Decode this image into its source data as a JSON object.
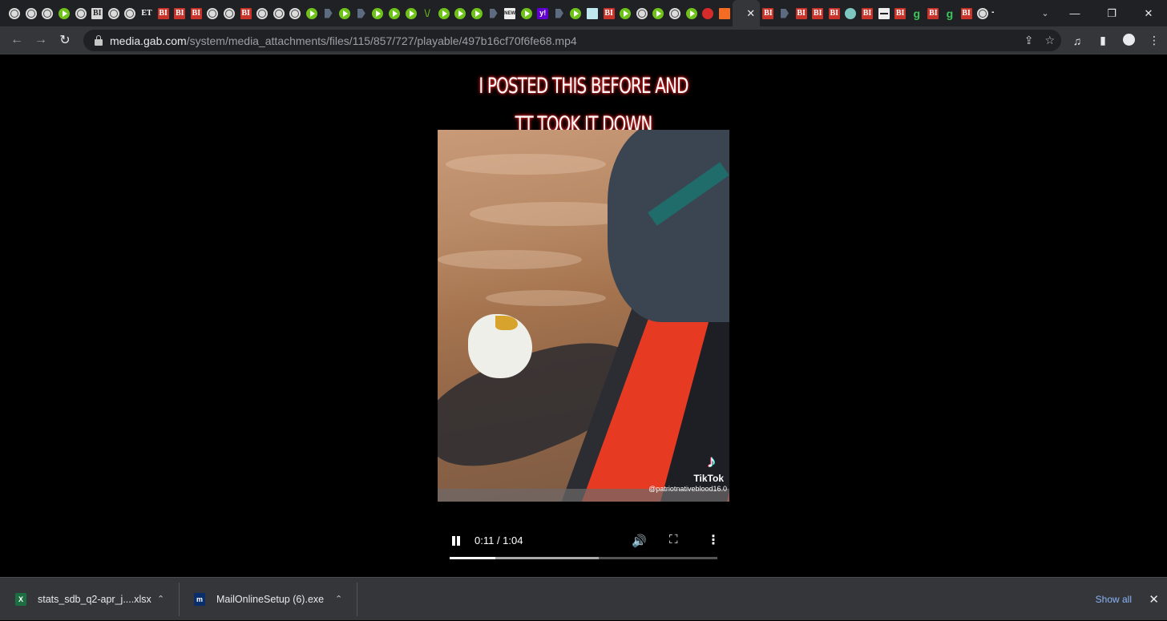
{
  "browser": {
    "tabs": [
      {
        "favicon": "globe-icon"
      },
      {
        "favicon": "globe-icon"
      },
      {
        "favicon": "globe-icon"
      },
      {
        "favicon": "play-icon"
      },
      {
        "favicon": "globe-icon"
      },
      {
        "favicon": "bi-grey-icon",
        "text": "BI"
      },
      {
        "favicon": "globe-icon"
      },
      {
        "favicon": "globe-icon"
      },
      {
        "favicon": "et-icon",
        "text": "ET"
      },
      {
        "favicon": "bi-icon",
        "text": "BI"
      },
      {
        "favicon": "bi-icon",
        "text": "BI"
      },
      {
        "favicon": "bi-icon",
        "text": "BI"
      },
      {
        "favicon": "globe-icon"
      },
      {
        "favicon": "globe-icon"
      },
      {
        "favicon": "bi-icon",
        "text": "BI"
      },
      {
        "favicon": "globe-icon"
      },
      {
        "favicon": "globe-icon"
      },
      {
        "favicon": "globe-icon"
      },
      {
        "favicon": "play-icon"
      },
      {
        "favicon": "arrow-icon"
      },
      {
        "favicon": "play-icon"
      },
      {
        "favicon": "arrow-icon"
      },
      {
        "favicon": "play-icon"
      },
      {
        "favicon": "play-icon"
      },
      {
        "favicon": "play-icon"
      },
      {
        "favicon": "v-icon",
        "text": "\\/"
      },
      {
        "favicon": "play-icon"
      },
      {
        "favicon": "play-icon"
      },
      {
        "favicon": "play-icon"
      },
      {
        "favicon": "arrow-icon"
      },
      {
        "favicon": "news-icon",
        "text": "NEW"
      },
      {
        "favicon": "play-icon"
      },
      {
        "favicon": "yahoo-icon",
        "text": "y!"
      },
      {
        "favicon": "arrow-icon"
      },
      {
        "favicon": "play-icon"
      },
      {
        "favicon": "grid-icon"
      },
      {
        "favicon": "bi-icon",
        "text": "BI"
      },
      {
        "favicon": "play-icon"
      },
      {
        "favicon": "globe-icon"
      },
      {
        "favicon": "play-icon"
      },
      {
        "favicon": "globe-icon"
      },
      {
        "favicon": "play-icon"
      },
      {
        "favicon": "red-icon"
      },
      {
        "favicon": "orange-icon"
      }
    ],
    "active_tab_close": "✕",
    "tabs_after": [
      {
        "favicon": "bi-icon",
        "text": "BI"
      },
      {
        "favicon": "arrow-icon"
      },
      {
        "favicon": "bi-icon",
        "text": "BI"
      },
      {
        "favicon": "bi-icon",
        "text": "BI"
      },
      {
        "favicon": "bi-icon",
        "text": "BI"
      },
      {
        "favicon": "teal-icon"
      },
      {
        "favicon": "bi-icon",
        "text": "BI"
      },
      {
        "favicon": "strike-icon"
      },
      {
        "favicon": "bi-icon",
        "text": "BI"
      },
      {
        "favicon": "g-icon",
        "text": "g"
      },
      {
        "favicon": "bi-icon",
        "text": "BI"
      },
      {
        "favicon": "g-icon",
        "text": "g"
      },
      {
        "favicon": "bi-icon",
        "text": "BI"
      },
      {
        "favicon": "globe-icon"
      }
    ],
    "new_tab": "+",
    "tab_search": "⌄",
    "window": {
      "minimize": "—",
      "restore": "❐",
      "close": "✕"
    },
    "nav": {
      "back": "←",
      "forward": "→",
      "reload": "↻"
    },
    "url": {
      "host": "media.gab.com",
      "path": "/system/media_attachments/files/115/857/727/playable/497b16cf70f6fe68.mp4"
    },
    "omnibox_icons": {
      "share": "⇪",
      "bookmark": "☆"
    },
    "toolbar_right": {
      "media": "♫",
      "sidepanel": "▮",
      "menu": "⋮"
    }
  },
  "video": {
    "caption_line1": "I POSTED THIS BEFORE AND",
    "caption_line2": "TT TOOK IT DOWN",
    "watermark_logo": "♪",
    "watermark_name": "TikTok",
    "watermark_handle": "@patriotnativeblood16.0",
    "current_time": "0:11",
    "duration": "1:04",
    "time_display": "0:11 / 1:04",
    "played_fraction": 0.172,
    "buffered_fraction": 0.558,
    "volume_icon": "🔊",
    "fullscreen_icon": "⛶",
    "more_icon": "⋮"
  },
  "downloads": {
    "items": [
      {
        "name": "stats_sdb_q2-apr_j....xlsx",
        "icon": "excel-file-icon",
        "icon_text": "X"
      },
      {
        "name": "MailOnlineSetup (6).exe",
        "icon": "mailonline-icon",
        "icon_text": "m"
      }
    ],
    "caret": "⌃",
    "show_all": "Show all",
    "close": "✕"
  }
}
